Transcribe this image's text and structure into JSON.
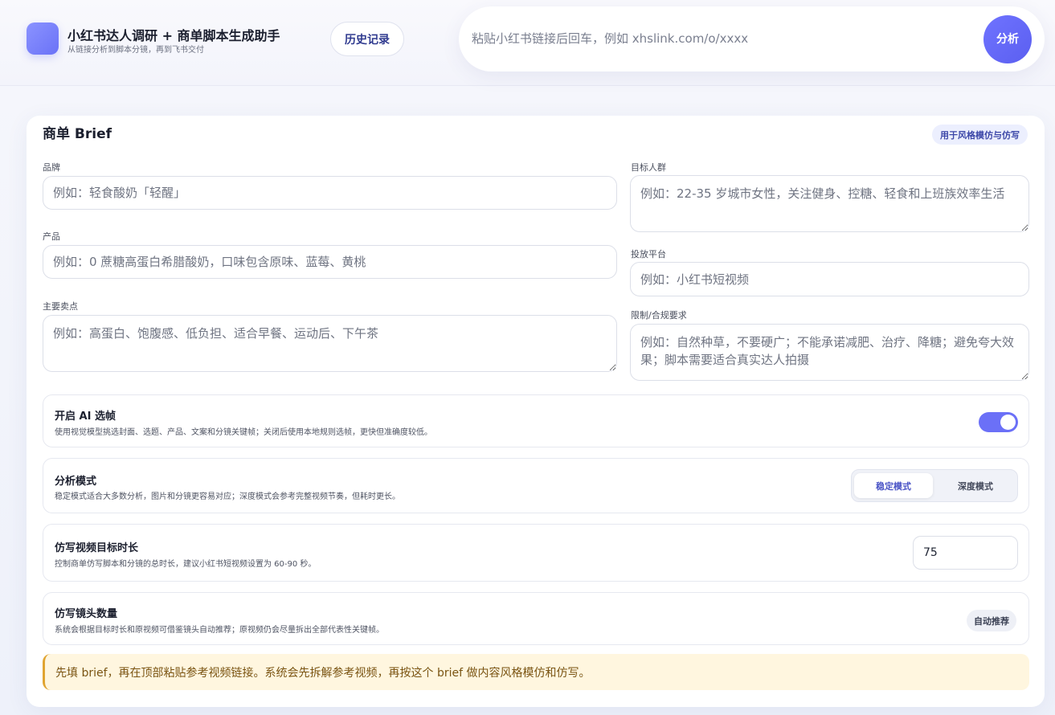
{
  "header": {
    "app_title": "小红书达人调研 + 商单脚本生成助手",
    "app_subtitle": "从链接分析到脚本分镜，再到飞书交付",
    "history_label": "历史记录",
    "search_placeholder": "粘贴小红书链接后回车，例如 xhslink.com/o/xxxx",
    "analyze_label": "分析",
    "accent_color": "#6b70f7"
  },
  "brief": {
    "title": "商单 Brief",
    "badge": "用于风格模仿与仿写",
    "brand": {
      "label": "品牌",
      "placeholder": "例如：轻食酸奶「轻醒」"
    },
    "product": {
      "label": "产品",
      "placeholder": "例如：0 蔗糖高蛋白希腊酸奶，口味包含原味、蓝莓、黄桃"
    },
    "selling_points": {
      "label": "主要卖点",
      "placeholder": "例如：高蛋白、饱腹感、低负担、适合早餐、运动后、下午茶"
    },
    "audience": {
      "label": "目标人群",
      "placeholder": "例如：22-35 岁城市女性，关注健身、控糖、轻食和上班族效率生活"
    },
    "platform": {
      "label": "投放平台",
      "placeholder": "例如：小红书短视频"
    },
    "constraints": {
      "label": "限制/合规要求",
      "placeholder": "例如：自然种草，不要硬广；不能承诺减肥、治疗、降糖；避免夸大效果；脚本需要适合真实达人拍摄"
    }
  },
  "options": {
    "ai_frames": {
      "title": "开启 AI 选帧",
      "desc": "使用视觉模型挑选封面、选题、产品、文案和分镜关键帧；关闭后使用本地规则选帧，更快但准确度较低。",
      "enabled": true
    },
    "mode": {
      "title": "分析模式",
      "desc": "稳定模式适合大多数分析，图片和分镜更容易对应；深度模式会参考完整视频节奏，但耗时更长。",
      "stable_label": "稳定模式",
      "deep_label": "深度模式",
      "selected": "稳定模式"
    },
    "duration": {
      "title": "仿写视频目标时长",
      "desc": "控制商单仿写脚本和分镜的总时长，建议小红书短视频设置为 60-90 秒。",
      "value": "75"
    },
    "shots": {
      "title": "仿写镜头数量",
      "desc": "系统会根据目标时长和原视频可借鉴镜头自动推荐；原视频仍会尽量拆出全部代表性关键帧。",
      "badge": "自动推荐"
    }
  },
  "notice": "先填 brief，再在顶部粘贴参考视频链接。系统会先拆解参考视频，再按这个 brief 做内容风格模仿和仿写。"
}
